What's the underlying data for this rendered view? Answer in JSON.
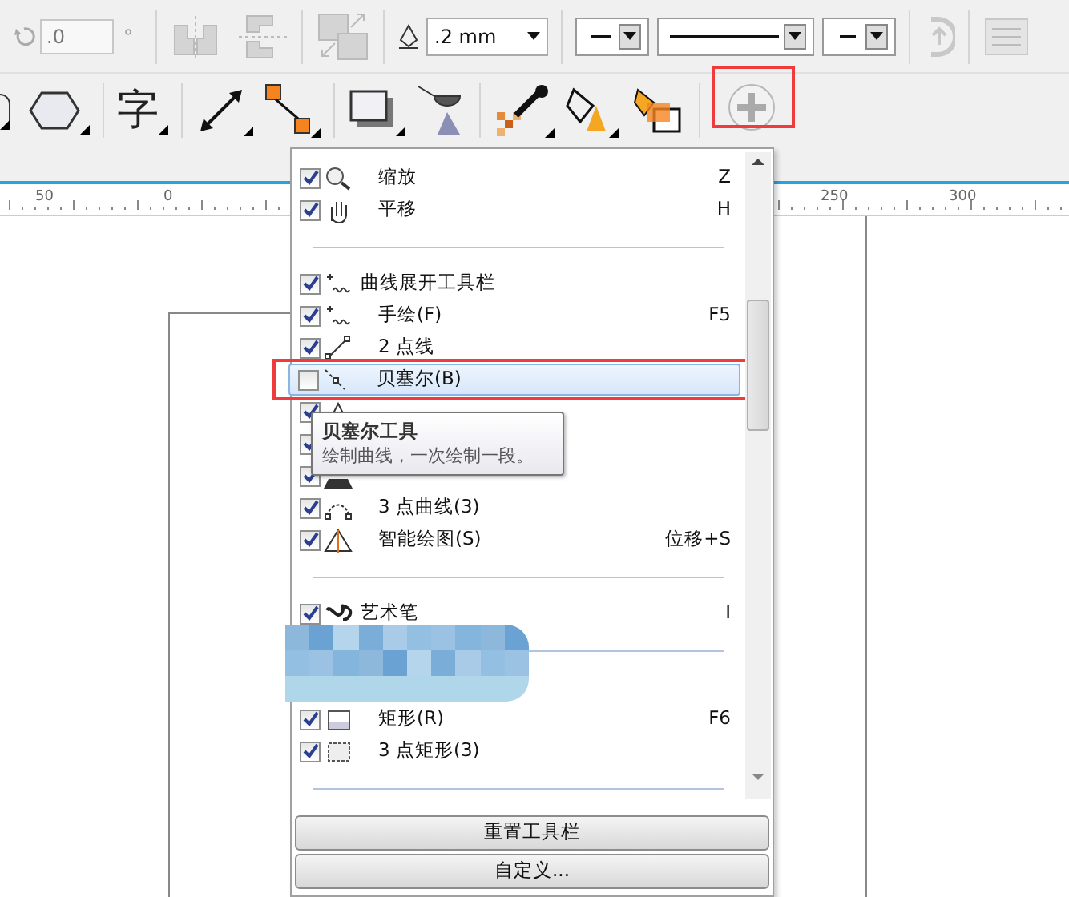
{
  "property_bar": {
    "rotation_field": {
      "value": ".0"
    },
    "degree_unit": "°",
    "outline_width": {
      "value": ".2 mm"
    }
  },
  "toolbox": {
    "text_tool_glyph": "字",
    "add_button": {
      "highlighted": true
    }
  },
  "ruler": {
    "labels": [
      "50",
      "0",
      "250",
      "300"
    ]
  },
  "menu": {
    "items": [
      {
        "kind": "item",
        "label": "缩放",
        "shortcut": "Z",
        "checked": true,
        "selected": false
      },
      {
        "kind": "item",
        "label": "平移",
        "shortcut": "H",
        "checked": true,
        "selected": false
      },
      {
        "kind": "separator"
      },
      {
        "kind": "header",
        "label": "曲线展开工具栏",
        "checked": true,
        "selected": false
      },
      {
        "kind": "item",
        "label": "手绘(F)",
        "shortcut": "F5",
        "checked": true,
        "selected": false
      },
      {
        "kind": "item",
        "label": "2 点线",
        "checked": true,
        "selected": false
      },
      {
        "kind": "item",
        "label": "贝塞尔(B)",
        "checked": false,
        "selected": true,
        "highlighted": true
      },
      {
        "kind": "item",
        "checked": true,
        "selected": false
      },
      {
        "kind": "item",
        "checked": true,
        "selected": false
      },
      {
        "kind": "item",
        "checked": true,
        "selected": false
      },
      {
        "kind": "item",
        "label": "3 点曲线(3)",
        "checked": true,
        "selected": false
      },
      {
        "kind": "item",
        "label": "智能绘图(S)",
        "shortcut": "位移+S",
        "checked": true,
        "selected": false
      },
      {
        "kind": "separator"
      },
      {
        "kind": "header",
        "label": "艺术笔",
        "shortcut": "I",
        "checked": true,
        "selected": false
      },
      {
        "kind": "separator"
      },
      {
        "kind": "obscured"
      },
      {
        "kind": "item",
        "label": "矩形(R)",
        "shortcut": "F6",
        "checked": true,
        "selected": false
      },
      {
        "kind": "item",
        "label": "3 点矩形(3)",
        "checked": true,
        "selected": false
      },
      {
        "kind": "separator"
      }
    ],
    "buttons": [
      "重置工具栏",
      "自定义..."
    ]
  },
  "tooltip": {
    "title": "贝塞尔工具",
    "text": "绘制曲线，一次绘制一段。"
  }
}
